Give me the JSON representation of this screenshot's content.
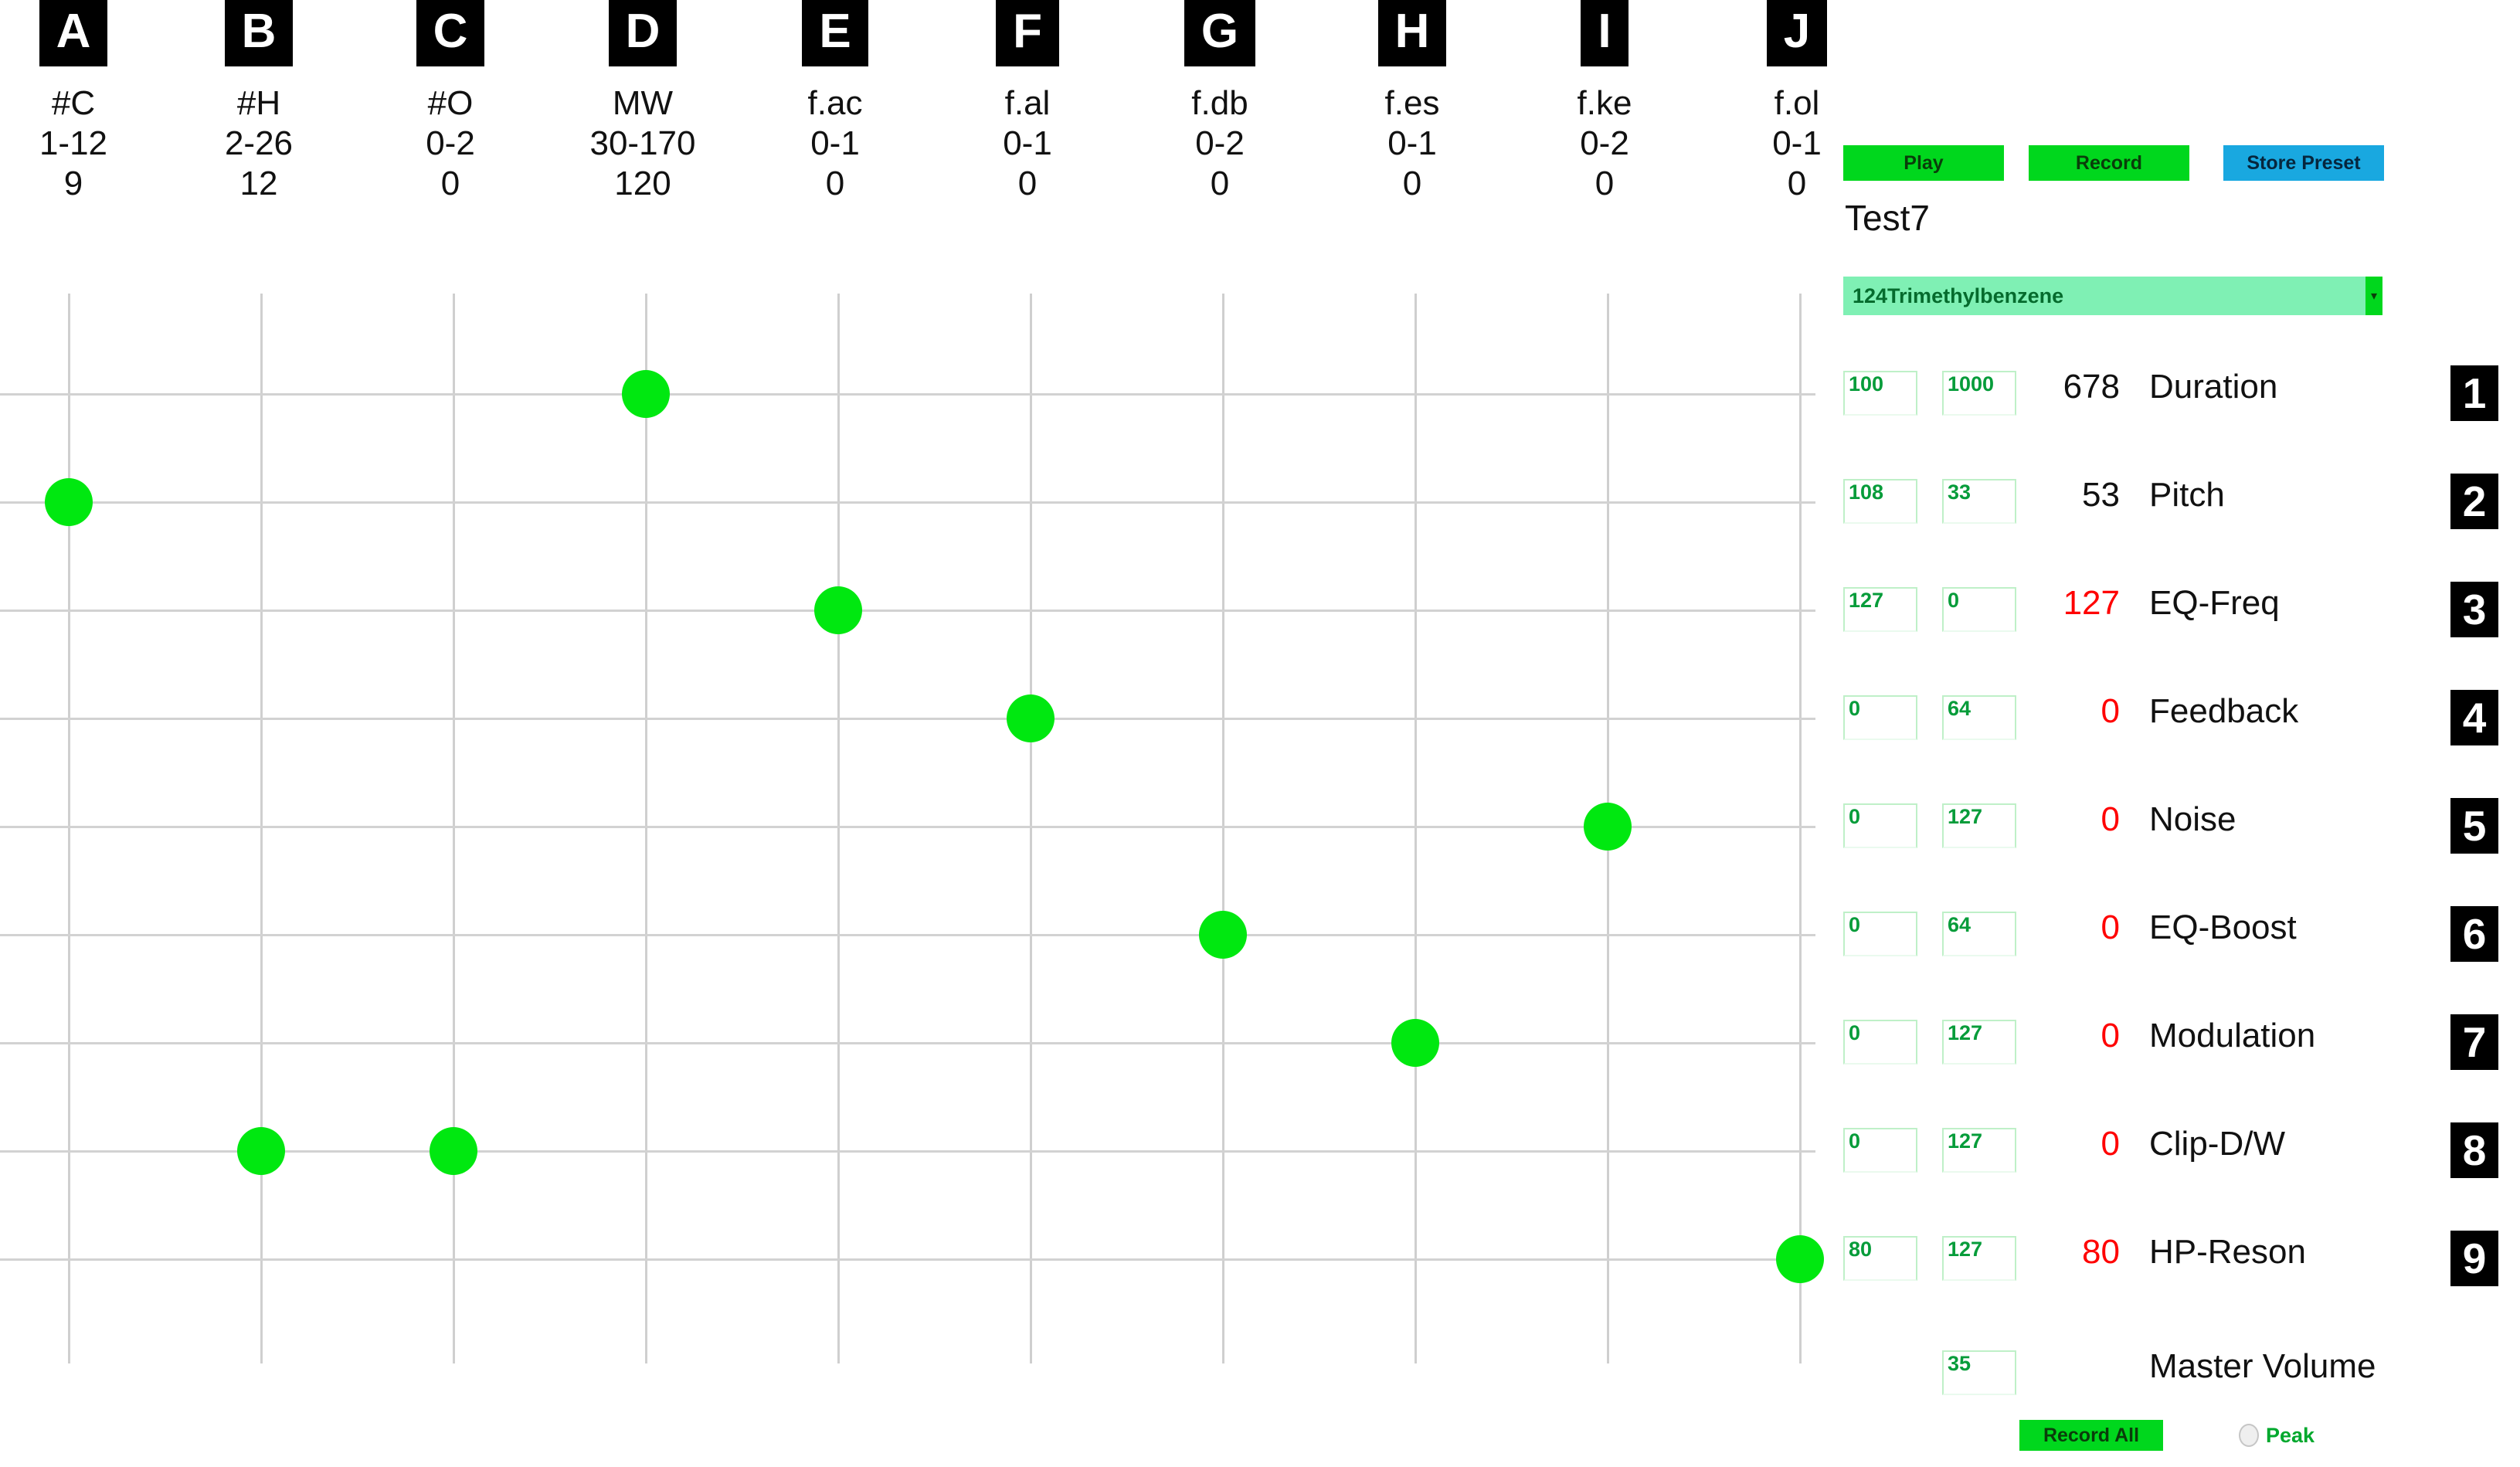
{
  "columns": [
    {
      "badge": "A",
      "name": "#C",
      "range": "1-12",
      "value": "9"
    },
    {
      "badge": "B",
      "name": "#H",
      "range": "2-26",
      "value": "12"
    },
    {
      "badge": "C",
      "name": "#O",
      "range": "0-2",
      "value": "0"
    },
    {
      "badge": "D",
      "name": "MW",
      "range": "30-170",
      "value": "120"
    },
    {
      "badge": "E",
      "name": "f.ac",
      "range": "0-1",
      "value": "0"
    },
    {
      "badge": "F",
      "name": "f.al",
      "range": "0-1",
      "value": "0"
    },
    {
      "badge": "G",
      "name": "f.db",
      "range": "0-2",
      "value": "0"
    },
    {
      "badge": "H",
      "name": "f.es",
      "range": "0-1",
      "value": "0"
    },
    {
      "badge": "I",
      "name": "f.ke",
      "range": "0-2",
      "value": "0"
    },
    {
      "badge": "J",
      "name": "f.ol",
      "range": "0-1",
      "value": "0"
    }
  ],
  "toolbar": {
    "play_label": "Play",
    "record_label": "Record",
    "store_preset_label": "Store Preset",
    "play_color": "#00d71d",
    "record_color": "#00d71d",
    "store_color": "#19a8e0"
  },
  "preset": {
    "name": "Test7",
    "selected_compound": "124Trimethylbenzene",
    "dropdown_arrow": "▾"
  },
  "parameters": [
    {
      "index": "1",
      "min": "100",
      "max": "1000",
      "value": "678",
      "label": "Duration",
      "value_color": "#111111"
    },
    {
      "index": "2",
      "min": "108",
      "max": "33",
      "value": "53",
      "label": "Pitch",
      "value_color": "#111111"
    },
    {
      "index": "3",
      "min": "127",
      "max": "0",
      "value": "127",
      "label": "EQ-Freq",
      "value_color": "#ff0000"
    },
    {
      "index": "4",
      "min": "0",
      "max": "64",
      "value": "0",
      "label": "Feedback",
      "value_color": "#ff0000"
    },
    {
      "index": "5",
      "min": "0",
      "max": "127",
      "value": "0",
      "label": "Noise",
      "value_color": "#ff0000"
    },
    {
      "index": "6",
      "min": "0",
      "max": "64",
      "value": "0",
      "label": "EQ-Boost",
      "value_color": "#ff0000"
    },
    {
      "index": "7",
      "min": "0",
      "max": "127",
      "value": "0",
      "label": "Modulation",
      "value_color": "#ff0000"
    },
    {
      "index": "8",
      "min": "0",
      "max": "127",
      "value": "0",
      "label": "Clip-D/W",
      "value_color": "#ff0000"
    },
    {
      "index": "9",
      "min": "80",
      "max": "127",
      "value": "80",
      "label": "HP-Reson",
      "value_color": "#ff0000"
    }
  ],
  "master_volume": {
    "value": "35",
    "label": "Master Volume"
  },
  "footer": {
    "record_all_label": "Record All",
    "peak_label": "Peak",
    "peak_color": "#00a82d"
  },
  "chart_data": {
    "type": "scatter",
    "title": "",
    "xlabel": "",
    "ylabel": "",
    "grid": true,
    "legend": "none",
    "dot_color": "#00e810",
    "x_categories": [
      "A",
      "B",
      "C",
      "D",
      "E",
      "F",
      "G",
      "H",
      "I",
      "J"
    ],
    "y_categories": [
      "Duration",
      "Pitch",
      "EQ-Freq",
      "Feedback",
      "Noise",
      "EQ-Boost",
      "Modulation",
      "Clip-D/W",
      "HP-Reson"
    ],
    "points": [
      {
        "x_label": "A",
        "y_label": "Pitch",
        "x_index": 0,
        "y_index": 1
      },
      {
        "x_label": "B",
        "y_label": "Clip-D/W",
        "x_index": 1,
        "y_index": 7
      },
      {
        "x_label": "C",
        "y_label": "Clip-D/W",
        "x_index": 2,
        "y_index": 7
      },
      {
        "x_label": "D",
        "y_label": "Duration",
        "x_index": 3,
        "y_index": 0
      },
      {
        "x_label": "E",
        "y_label": "EQ-Freq",
        "x_index": 4,
        "y_index": 2
      },
      {
        "x_label": "F",
        "y_label": "Feedback",
        "x_index": 5,
        "y_index": 3
      },
      {
        "x_label": "G",
        "y_label": "EQ-Boost",
        "x_index": 6,
        "y_index": 5
      },
      {
        "x_label": "H",
        "y_label": "Modulation",
        "x_index": 7,
        "y_index": 6
      },
      {
        "x_label": "I",
        "y_label": "Noise",
        "x_index": 8,
        "y_index": 4
      },
      {
        "x_label": "J",
        "y_label": "HP-Reson",
        "x_index": 9,
        "y_index": 8
      }
    ]
  }
}
